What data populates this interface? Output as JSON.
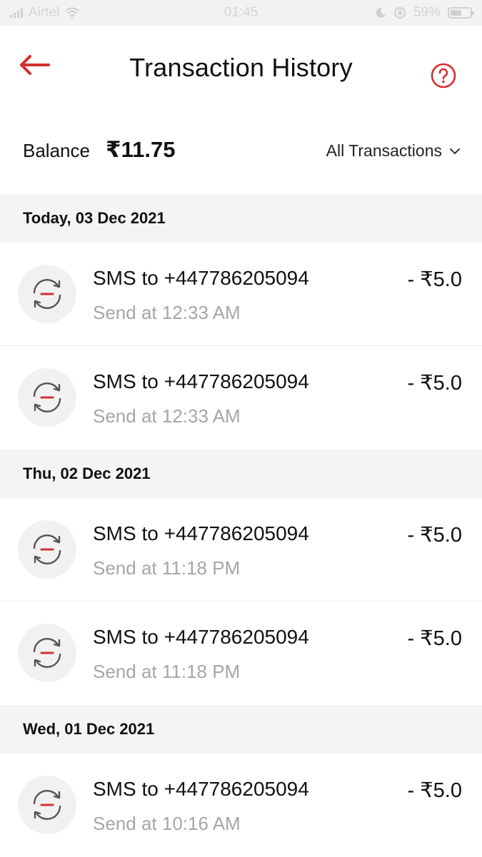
{
  "status_bar": {
    "carrier": "Airtel",
    "time": "01:45",
    "battery": "59%",
    "battery_level": 0.59
  },
  "header": {
    "title": "Transaction History",
    "back_icon": "arrow-left-icon",
    "help_icon": "question-circle-icon",
    "accent_color": "#d32f2f"
  },
  "balance": {
    "label": "Balance",
    "value": "₹11.75"
  },
  "filter": {
    "label": "All Transactions",
    "icon": "chevron-down-icon"
  },
  "sections": [
    {
      "date": "Today, 03 Dec 2021",
      "transactions": [
        {
          "title": "SMS to +447786205094",
          "subtitle": "Send at 12:33 AM",
          "amount": "- ₹5.0"
        },
        {
          "title": "SMS to +447786205094",
          "subtitle": "Send at 12:33 AM",
          "amount": "- ₹5.0"
        }
      ]
    },
    {
      "date": "Thu, 02 Dec 2021",
      "transactions": [
        {
          "title": "SMS to +447786205094",
          "subtitle": "Send at 11:18 PM",
          "amount": "- ₹5.0"
        },
        {
          "title": "SMS to +447786205094",
          "subtitle": "Send at 11:18 PM",
          "amount": "- ₹5.0"
        }
      ]
    },
    {
      "date": "Wed, 01 Dec 2021",
      "transactions": [
        {
          "title": "SMS to +447786205094",
          "subtitle": "Send at 10:16 AM",
          "amount": "- ₹5.0"
        }
      ]
    }
  ]
}
